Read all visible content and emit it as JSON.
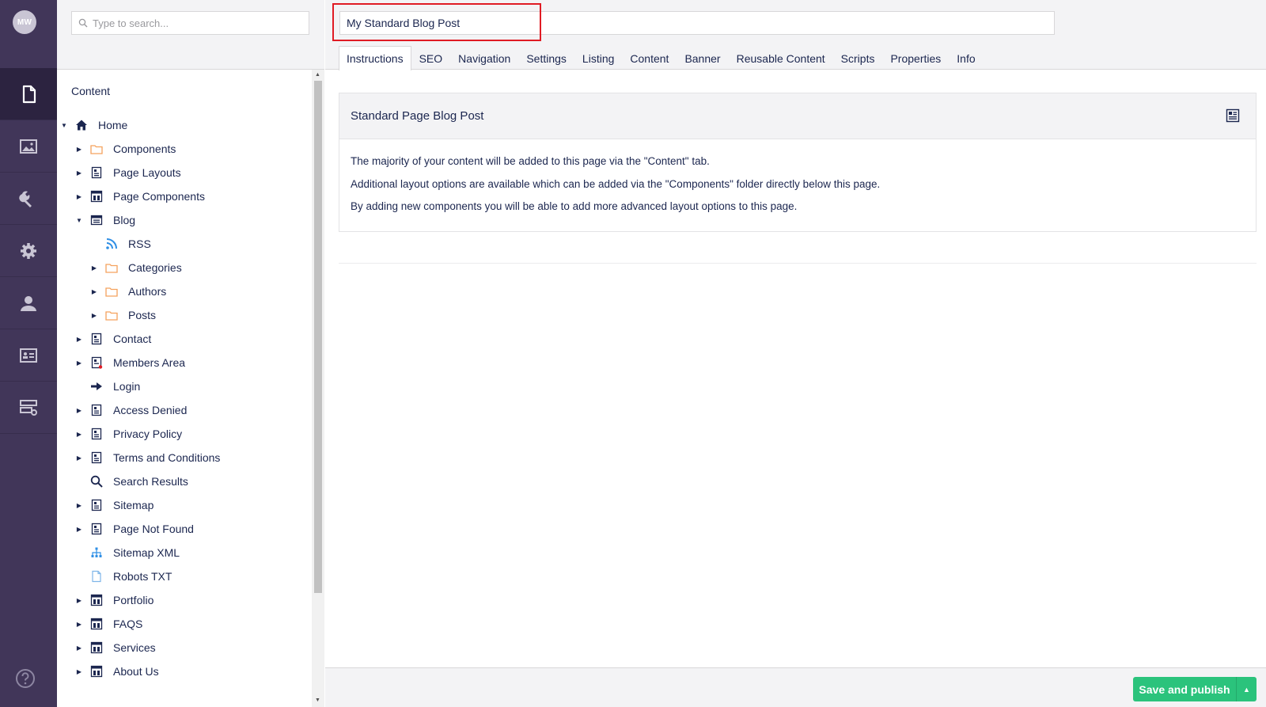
{
  "user": {
    "initials": "MW"
  },
  "rail": {
    "sections": [
      {
        "icon": "document-icon",
        "active": true
      },
      {
        "icon": "image-icon",
        "active": false
      },
      {
        "icon": "wrench-icon",
        "active": false
      },
      {
        "icon": "gear-icon",
        "active": false
      },
      {
        "icon": "user-icon",
        "active": false
      },
      {
        "icon": "id-card-icon",
        "active": false
      },
      {
        "icon": "forms-icon",
        "active": false
      }
    ],
    "help_icon": "help-icon"
  },
  "tree": {
    "search_placeholder": "Type to search...",
    "title": "Content",
    "nodes": [
      {
        "label": "Home",
        "icon": "home-icon",
        "caret": "open"
      },
      {
        "label": "Components",
        "icon": "folder-icon",
        "caret": "closed"
      },
      {
        "label": "Page Layouts",
        "icon": "page-icon",
        "caret": "closed"
      },
      {
        "label": "Page Components",
        "icon": "layout-icon",
        "caret": "closed"
      },
      {
        "label": "Blog",
        "icon": "newspaper-icon",
        "caret": "open"
      },
      {
        "label": "RSS",
        "icon": "rss-icon",
        "caret": "none"
      },
      {
        "label": "Categories",
        "icon": "folder-icon",
        "caret": "closed"
      },
      {
        "label": "Authors",
        "icon": "folder-icon",
        "caret": "closed"
      },
      {
        "label": "Posts",
        "icon": "folder-icon",
        "caret": "closed"
      },
      {
        "label": "Contact",
        "icon": "page-icon",
        "caret": "closed"
      },
      {
        "label": "Members Area",
        "icon": "page-locked-icon",
        "caret": "closed"
      },
      {
        "label": "Login",
        "icon": "arrow-right-icon",
        "caret": "none"
      },
      {
        "label": "Access Denied",
        "icon": "page-icon",
        "caret": "closed"
      },
      {
        "label": "Privacy Policy",
        "icon": "page-icon",
        "caret": "closed"
      },
      {
        "label": "Terms and Conditions",
        "icon": "page-icon",
        "caret": "closed"
      },
      {
        "label": "Search Results",
        "icon": "search-icon",
        "caret": "none"
      },
      {
        "label": "Sitemap",
        "icon": "page-icon",
        "caret": "closed"
      },
      {
        "label": "Page Not Found",
        "icon": "page-icon",
        "caret": "closed"
      },
      {
        "label": "Sitemap XML",
        "icon": "sitemap-icon",
        "caret": "none"
      },
      {
        "label": "Robots TXT",
        "icon": "file-icon",
        "caret": "none"
      },
      {
        "label": "Portfolio",
        "icon": "layout-icon",
        "caret": "closed"
      },
      {
        "label": "FAQS",
        "icon": "layout-icon",
        "caret": "closed"
      },
      {
        "label": "Services",
        "icon": "layout-icon",
        "caret": "closed"
      },
      {
        "label": "About Us",
        "icon": "layout-icon",
        "caret": "closed"
      }
    ]
  },
  "editor": {
    "name_value": "My Standard Blog Post",
    "tabs": [
      "Instructions",
      "SEO",
      "Navigation",
      "Settings",
      "Listing",
      "Content",
      "Banner",
      "Reusable Content",
      "Scripts",
      "Properties",
      "Info"
    ],
    "active_tab": "Instructions",
    "panel": {
      "title": "Standard Page Blog Post",
      "lines": [
        "The majority of your content will be added to this page via the \"Content\" tab.",
        "Additional layout options are available which can be added via the \"Components\" folder directly below this page.",
        "By adding new components you will be able to add more advanced layout options to this page."
      ]
    },
    "publish_label": "Save and publish"
  },
  "colors": {
    "rail_bg": "#413659",
    "rail_active": "#2c2340",
    "publish_green": "#2bc37c",
    "highlight_red": "#e01b24",
    "folder_orange": "#f5a25d",
    "rss_blue": "#2f8fe5"
  }
}
